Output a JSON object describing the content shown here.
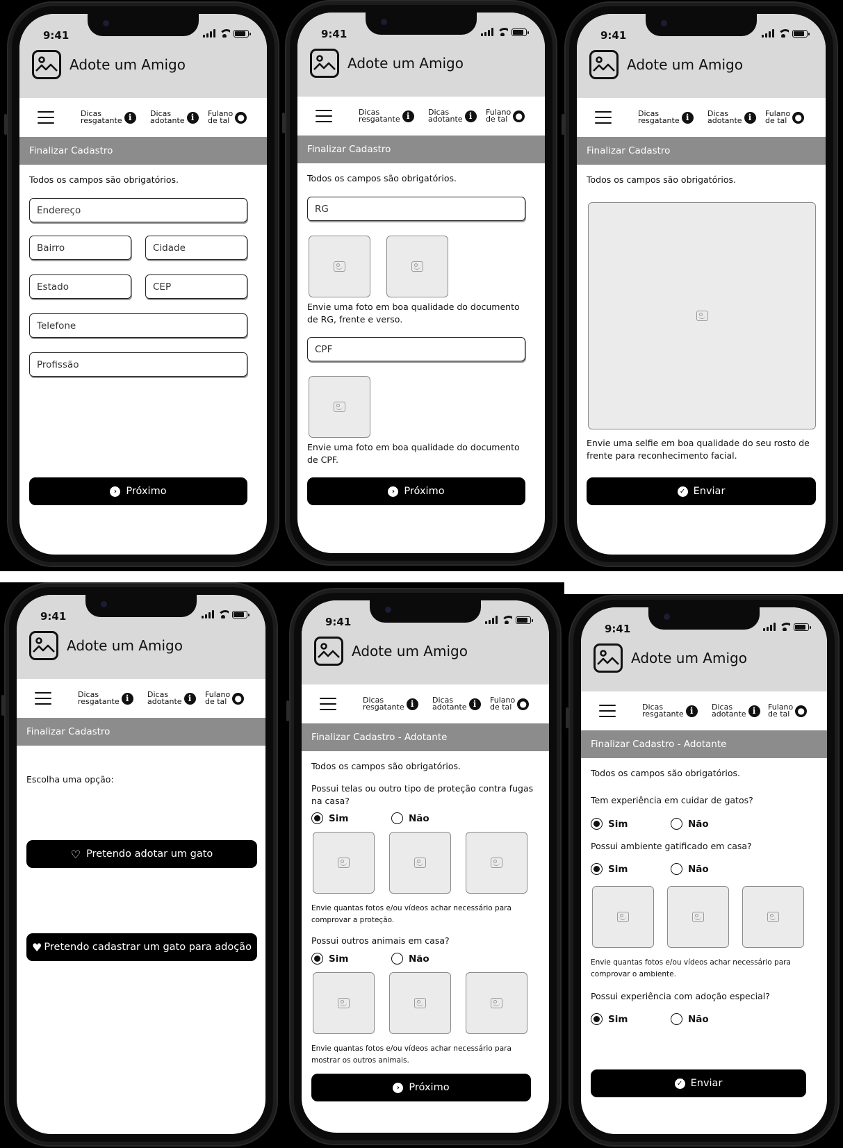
{
  "app": {
    "time": "9:41",
    "title": "Adote um Amigo",
    "nav": {
      "tips_rescuer_line1": "Dicas",
      "tips_rescuer_line2": "resgatante",
      "tips_adopter_line1": "Dicas",
      "tips_adopter_line2": "adotante",
      "user_line1": "Fulano",
      "user_line2": "de tal"
    },
    "info_icon": "i",
    "next_label": "Próximo",
    "send_label": "Enviar",
    "required_notice": "Todos os campos são obrigatórios.",
    "yes": "Sim",
    "no": "Não"
  },
  "icons": {
    "menu": "hamburger-icon",
    "info": "info-icon",
    "user": "user-icon",
    "logo": "image-icon",
    "next": "arrow-right-circle-icon",
    "send": "check-circle-icon",
    "heart_outline": "heart-outline-icon",
    "heart_filled": "heart-filled-icon"
  },
  "screen1": {
    "section": "Finalizar Cadastro",
    "fields": {
      "endereco": "Endereço",
      "bairro": "Bairro",
      "cidade": "Cidade",
      "estado": "Estado",
      "cep": "CEP",
      "telefone": "Telefone",
      "profissao": "Profissão"
    }
  },
  "screen2": {
    "section": "Finalizar Cadastro",
    "rg_field": "RG",
    "rg_hint": "Envie uma foto em boa qualidade do documento de RG, frente e verso.",
    "cpf_field": "CPF",
    "cpf_hint": "Envie uma foto em boa qualidade do documento de CPF."
  },
  "screen3": {
    "section": "Finalizar Cadastro",
    "selfie_hint": "Envie uma selfie em boa qualidade do seu rosto de frente para reconhecimento facial."
  },
  "screen4": {
    "section": "Finalizar Cadastro",
    "prompt": "Escolha uma opção:",
    "adopt_label": "Pretendo adotar um gato",
    "register_label": "Pretendo cadastrar um gato para adoção"
  },
  "screen5": {
    "section": "Finalizar Cadastro - Adotante",
    "q1": "Possui telas ou outro tipo de proteção contra fugas na casa?",
    "q1_hint": "Envie quantas fotos e/ou vídeos achar necessário para comprovar a proteção.",
    "q2": "Possui outros animais em casa?",
    "q2_hint": "Envie quantas fotos e/ou vídeos achar necessário para mostrar os outros animais."
  },
  "screen6": {
    "section": "Finalizar Cadastro - Adotante",
    "q1": "Tem experiência em cuidar de gatos?",
    "q2": "Possui ambiente gatificado em casa?",
    "q2_hint": "Envie quantas fotos e/ou vídeos achar necessário para comprovar o ambiente.",
    "q3": "Possui experiência com adoção especial?"
  }
}
